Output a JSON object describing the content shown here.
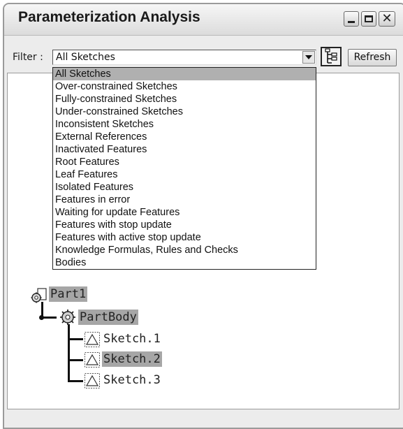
{
  "window": {
    "title": "Parameterization Analysis"
  },
  "filter": {
    "label": "Filter :",
    "selected": "All Sketches",
    "options": [
      "All Sketches",
      "Over-constrained Sketches",
      "Fully-constrained Sketches",
      "Under-constrained Sketches",
      "Inconsistent Sketches",
      "External References",
      "Inactivated Features",
      "Root Features",
      "Leaf Features",
      "Isolated Features",
      "Features in error",
      "Waiting for update Features",
      "Features with stop update",
      "Features with active stop update",
      "Knowledge Formulas, Rules and Checks",
      "Bodies"
    ]
  },
  "toolbar": {
    "refresh_label": "Refresh"
  },
  "tree": {
    "root": "Part1",
    "body": "PartBody",
    "sketches": [
      "Sketch.1",
      "Sketch.2",
      "Sketch.3"
    ]
  },
  "icons": {
    "part": "part-gear-icon",
    "body": "partbody-gear-icon",
    "sketch": "sketch-icon",
    "tree_view": "tree-view-icon"
  }
}
